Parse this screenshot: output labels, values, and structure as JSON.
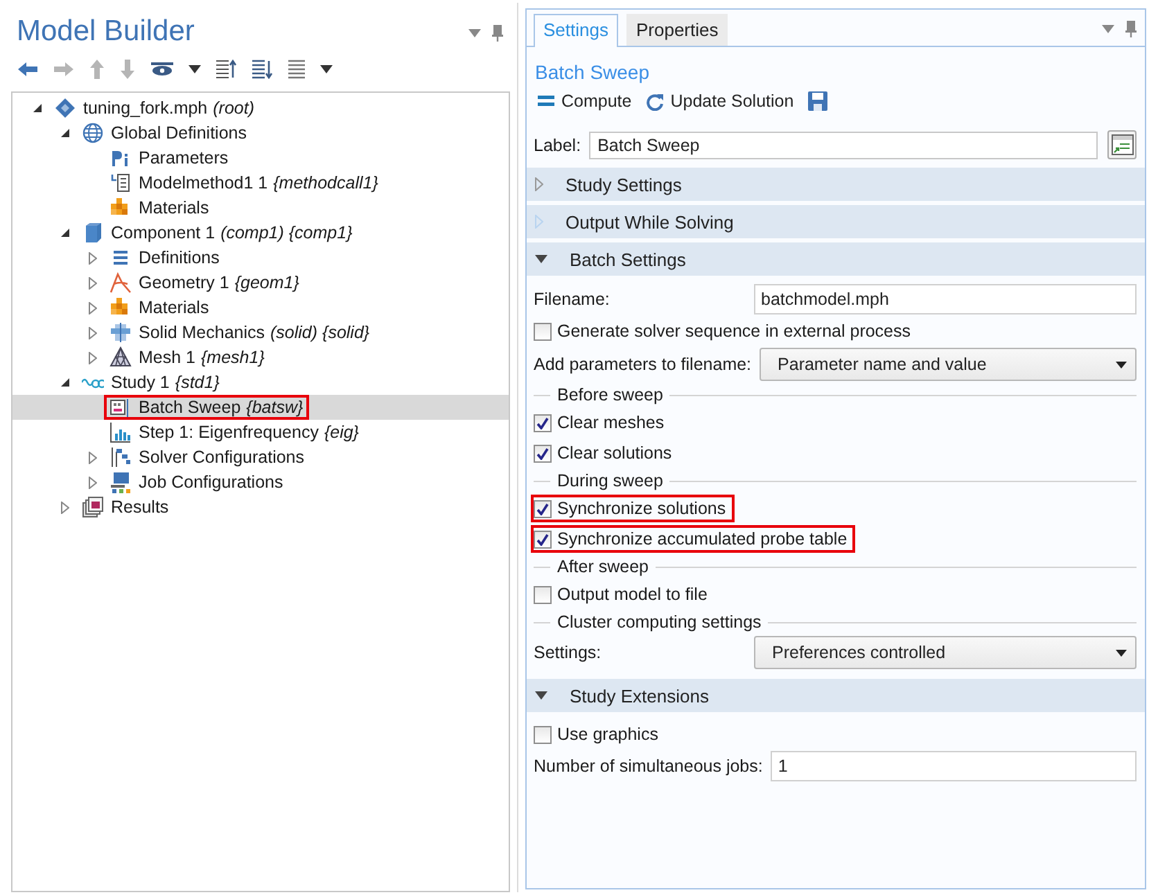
{
  "model_builder": {
    "title": "Model Builder",
    "toolbar": [
      {
        "kind": "back",
        "disabled": false
      },
      {
        "kind": "forward",
        "disabled": true
      },
      {
        "kind": "up",
        "disabled": true
      },
      {
        "kind": "down",
        "disabled": true
      },
      {
        "kind": "view",
        "disabled": false
      },
      {
        "kind": "caret",
        "disabled": false
      },
      {
        "kind": "collapse",
        "disabled": false
      },
      {
        "kind": "expand",
        "disabled": false
      },
      {
        "kind": "list",
        "disabled": false
      },
      {
        "kind": "caret",
        "disabled": false
      }
    ],
    "tree": [
      {
        "label": "tuning_fork.mph",
        "tag": "(root)",
        "kind": "root",
        "expanded": true,
        "selected": false,
        "annotated": false,
        "children": [
          {
            "label": "Global Definitions",
            "kind": "globe",
            "expanded": true,
            "selected": false,
            "annotated": false,
            "children": [
              {
                "label": "Parameters",
                "kind": "pi",
                "selected": false,
                "annotated": false
              },
              {
                "label": "Modelmethod1 1",
                "tag": "{methodcall1}",
                "kind": "method",
                "selected": false,
                "annotated": false
              },
              {
                "label": "Materials",
                "kind": "materials",
                "selected": false,
                "annotated": false
              }
            ]
          },
          {
            "label": "Component 1",
            "tag": "(comp1) {comp1}",
            "kind": "component",
            "expanded": true,
            "selected": false,
            "annotated": false,
            "children": [
              {
                "label": "Definitions",
                "kind": "definitions",
                "expanded": false,
                "selected": false,
                "annotated": false
              },
              {
                "label": "Geometry 1",
                "tag": "{geom1}",
                "kind": "geometry",
                "expanded": false,
                "selected": false,
                "annotated": false
              },
              {
                "label": "Materials",
                "kind": "materials",
                "expanded": false,
                "selected": false,
                "annotated": false
              },
              {
                "label": "Solid Mechanics",
                "tag": "(solid) {solid}",
                "kind": "physics",
                "expanded": false,
                "selected": false,
                "annotated": false
              },
              {
                "label": "Mesh 1",
                "tag": "{mesh1}",
                "kind": "mesh",
                "expanded": false,
                "selected": false,
                "annotated": false
              }
            ]
          },
          {
            "label": "Study 1",
            "tag": "{std1}",
            "kind": "study",
            "expanded": true,
            "selected": false,
            "annotated": false,
            "children": [
              {
                "label": "Batch Sweep",
                "tag": "{batsw}",
                "kind": "batch",
                "selected": true,
                "annotated": true
              },
              {
                "label": "Step 1: Eigenfrequency",
                "tag": "{eig}",
                "kind": "step",
                "selected": false,
                "annotated": false
              },
              {
                "label": "Solver Configurations",
                "kind": "solver",
                "expanded": false,
                "selected": false,
                "annotated": false
              },
              {
                "label": "Job Configurations",
                "kind": "job",
                "expanded": false,
                "selected": false,
                "annotated": false
              }
            ]
          },
          {
            "label": "Results",
            "kind": "results",
            "expanded": false,
            "selected": false,
            "annotated": false
          }
        ]
      }
    ]
  },
  "settings": {
    "tabs": [
      {
        "label": "Settings",
        "selected": true
      },
      {
        "label": "Properties",
        "selected": false
      }
    ],
    "title": "Batch Sweep",
    "toolbar": [
      {
        "kind": "compute",
        "label": "Compute"
      },
      {
        "kind": "update",
        "label": "Update Solution"
      },
      {
        "kind": "save"
      }
    ],
    "label_field": {
      "label": "Label:",
      "value": "Batch Sweep"
    },
    "sections": [
      {
        "title": "Study Settings",
        "expanded": false,
        "disabled": false
      },
      {
        "title": "Output While Solving",
        "expanded": false,
        "disabled": true
      },
      {
        "title": "Batch Settings",
        "expanded": true,
        "disabled": false,
        "rows": [
          {
            "kind": "field",
            "label": "Filename:",
            "value": "batchmodel.mph"
          },
          {
            "kind": "checkbox",
            "label": "Generate solver sequence in external process",
            "checked": false,
            "annotated": false
          },
          {
            "kind": "select",
            "label": "Add parameters to filename:",
            "value": "Parameter name and value"
          },
          {
            "kind": "group",
            "label": "Before sweep"
          },
          {
            "kind": "checkbox",
            "label": "Clear meshes",
            "checked": true,
            "annotated": false
          },
          {
            "kind": "checkbox",
            "label": "Clear solutions",
            "checked": true,
            "annotated": false
          },
          {
            "kind": "group",
            "label": "During sweep"
          },
          {
            "kind": "checkbox",
            "label": "Synchronize solutions",
            "checked": true,
            "annotated": true
          },
          {
            "kind": "checkbox",
            "label": "Synchronize accumulated probe table",
            "checked": true,
            "annotated": true
          },
          {
            "kind": "group",
            "label": "After sweep"
          },
          {
            "kind": "checkbox",
            "label": "Output model to file",
            "checked": false,
            "annotated": false
          },
          {
            "kind": "group",
            "label": "Cluster computing settings"
          },
          {
            "kind": "select",
            "label": "Settings:",
            "value": "Preferences controlled"
          }
        ]
      },
      {
        "title": "Study Extensions",
        "expanded": true,
        "disabled": false,
        "rows": [
          {
            "kind": "checkbox",
            "label": "Use graphics",
            "checked": false,
            "annotated": false
          },
          {
            "kind": "field",
            "label": "Number of simultaneous jobs:",
            "value": "1"
          }
        ]
      }
    ]
  }
}
